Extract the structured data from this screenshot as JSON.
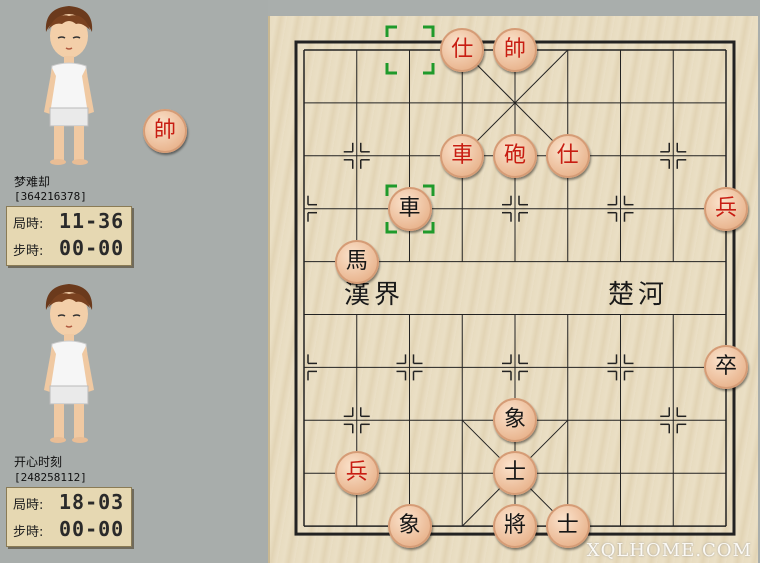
{
  "players": [
    {
      "name": "梦难却",
      "id": "[364216378]",
      "game_label": "局時:",
      "game_time": "11-36",
      "step_label": "步時:",
      "step_time": "00-00"
    },
    {
      "name": "开心时刻",
      "id": "[248258112]",
      "game_label": "局時:",
      "game_time": "18-03",
      "step_label": "步時:",
      "step_time": "00-00"
    }
  ],
  "captured_piece": {
    "char": "帥",
    "color": "red"
  },
  "river": {
    "left": "漢界",
    "right": "楚河"
  },
  "pieces": [
    {
      "char": "仕",
      "color": "red",
      "col": 3,
      "row": 0
    },
    {
      "char": "帥",
      "color": "red",
      "col": 4,
      "row": 0
    },
    {
      "char": "車",
      "color": "red",
      "col": 3,
      "row": 2
    },
    {
      "char": "砲",
      "color": "red",
      "col": 4,
      "row": 2
    },
    {
      "char": "仕",
      "color": "red",
      "col": 5,
      "row": 2
    },
    {
      "char": "車",
      "color": "black",
      "col": 2,
      "row": 3
    },
    {
      "char": "兵",
      "color": "red",
      "col": 8,
      "row": 3
    },
    {
      "char": "馬",
      "color": "black",
      "col": 1,
      "row": 4
    },
    {
      "char": "卒",
      "color": "black",
      "col": 8,
      "row": 6
    },
    {
      "char": "象",
      "color": "black",
      "col": 4,
      "row": 7
    },
    {
      "char": "兵",
      "color": "red",
      "col": 1,
      "row": 8
    },
    {
      "char": "士",
      "color": "black",
      "col": 4,
      "row": 8
    },
    {
      "char": "象",
      "color": "black",
      "col": 2,
      "row": 9
    },
    {
      "char": "將",
      "color": "black",
      "col": 4,
      "row": 9
    },
    {
      "char": "士",
      "color": "black",
      "col": 5,
      "row": 9
    }
  ],
  "selection_markers": [
    {
      "col": 2,
      "row": 0
    },
    {
      "col": 2,
      "row": 3
    }
  ],
  "watermark": "XQLHOME.COM",
  "colors": {
    "red_piece_text": "#c81d12",
    "black_piece_text": "#161616",
    "selection": "#1f9a2b"
  }
}
